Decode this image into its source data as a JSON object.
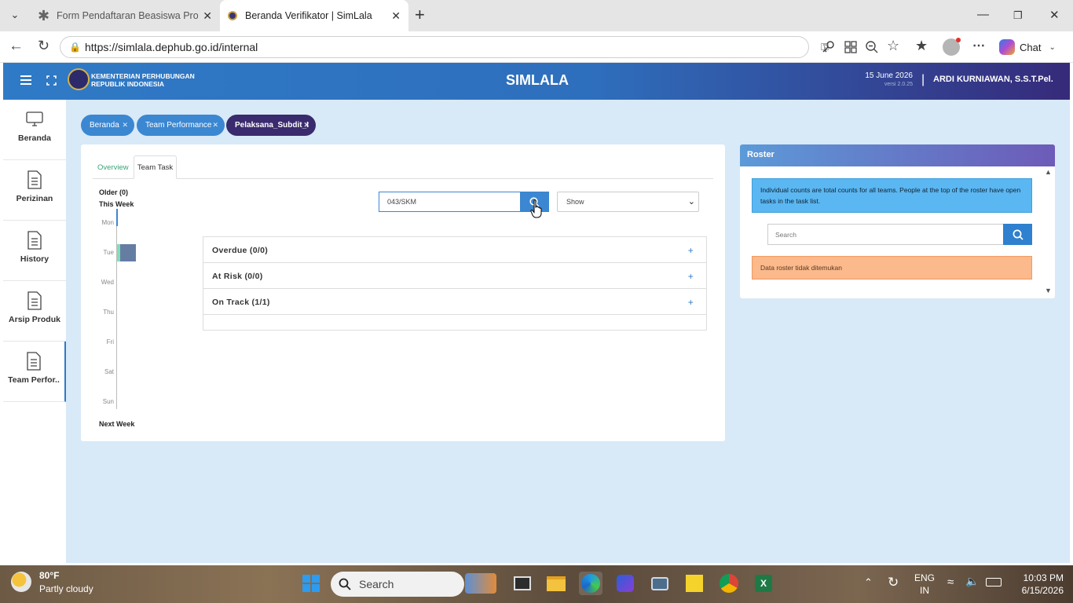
{
  "browser": {
    "tabs": [
      {
        "title": "Form Pendaftaran Beasiswa Progra",
        "active": false
      },
      {
        "title": "Beranda Verifikator | SimLala",
        "active": true
      }
    ],
    "url": "https://simlala.dephub.go.id/internal",
    "chat_label": "Chat"
  },
  "header": {
    "org_line1": "KEMENTERIAN PERHUBUNGAN",
    "org_line2": "REPUBLIK INDONESIA",
    "app_title": "SIMLALA",
    "date": "15 June 2026",
    "version": "versi 2.0.25",
    "separator": "|",
    "user": "ARDI KURNIAWAN, S.S.T.Pel."
  },
  "sidebar": {
    "items": [
      {
        "label": "Beranda",
        "icon": "monitor-icon"
      },
      {
        "label": "Perizinan",
        "icon": "document-icon"
      },
      {
        "label": "History",
        "icon": "document-icon"
      },
      {
        "label": "Arsip Produk",
        "icon": "document-icon"
      },
      {
        "label": "Team Perfor..",
        "icon": "document-icon",
        "active": true
      }
    ]
  },
  "breadcrumbs": [
    {
      "label": "Beranda"
    },
    {
      "label": "Team Performance"
    },
    {
      "label": "Pelaksana_Subdit_I",
      "active": true
    }
  ],
  "main": {
    "tabs": [
      {
        "label": "Overview",
        "active": false
      },
      {
        "label": "Team Task",
        "active": true
      }
    ],
    "older": "Older (0)",
    "this_week": "This Week",
    "next_week": "Next Week",
    "days": [
      "Mon",
      "Tue",
      "Wed",
      "Thu",
      "Fri",
      "Sat",
      "Sun"
    ],
    "day_bars": [
      0,
      1,
      0,
      0,
      0,
      0,
      0
    ],
    "search_value": "043/SKM",
    "select_value": "Show",
    "groups": [
      {
        "label": "Overdue (0/0)",
        "toggle": "+"
      },
      {
        "label": "At Risk (0/0)",
        "toggle": "+"
      },
      {
        "label": "On Track (1/1)",
        "toggle": "+"
      }
    ]
  },
  "roster": {
    "title": "Roster",
    "info": "Individual counts are total counts for all teams. People at the top of the roster have open tasks in the task list.",
    "search_placeholder": "Search",
    "empty_message": "Data roster tidak ditemukan"
  },
  "taskbar": {
    "weather_temp": "80°F",
    "weather_desc": "Partly cloudy",
    "search_label": "Search",
    "lang1": "ENG",
    "lang2": "IN",
    "time": "10:03 PM",
    "date": "6/15/2026"
  },
  "colors": {
    "header_start": "#2f7ac6",
    "header_end": "#362a7a",
    "crumb_blue": "#3b87d1",
    "crumb_active": "#3a2a6e",
    "app_bg": "#d8e9f8",
    "info_bg": "#5ab7f2",
    "warning_bg": "#fbb98c"
  }
}
